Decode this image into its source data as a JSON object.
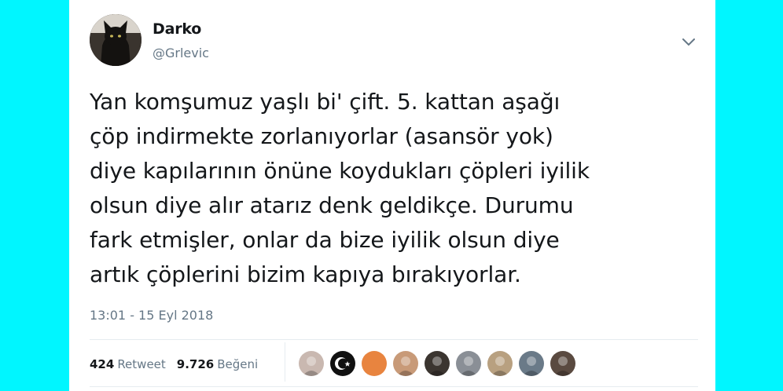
{
  "tweet": {
    "display_name": "Darko",
    "handle": "@Grlevic",
    "text_lines": [
      "Yan komşumuz yaşlı bi' çift. 5. kattan aşağı",
      "çöp indirmekte zorlanıyorlar (asansör yok)",
      "diye kapılarının önüne koydukları çöpleri iyilik",
      "olsun diye alır atarız denk geldikçe. Durumu",
      "fark etmişler, onlar da bize iyilik olsun diye",
      "artık çöplerini bizim kapıya bırakıyorlar."
    ],
    "timestamp": "13:01 - 15 Eyl 2018",
    "retweet_count": "424",
    "retweet_label": "Retweet",
    "like_count": "9.726",
    "like_label": "Beğeni"
  },
  "icons": {
    "caret": "chevron-down-icon",
    "avatar": "black-cat-avatar"
  },
  "likers": [
    {
      "name": "liker-avatar-1",
      "color": "#c9b8b0"
    },
    {
      "name": "liker-avatar-2",
      "color": "#111111"
    },
    {
      "name": "liker-avatar-3",
      "color": "#e8843f"
    },
    {
      "name": "liker-avatar-4",
      "color": "#c89a78"
    },
    {
      "name": "liker-avatar-5",
      "color": "#3b3530"
    },
    {
      "name": "liker-avatar-6",
      "color": "#8a8f96"
    },
    {
      "name": "liker-avatar-7",
      "color": "#b8a080"
    },
    {
      "name": "liker-avatar-8",
      "color": "#6a7a88"
    },
    {
      "name": "liker-avatar-9",
      "color": "#5a4a40"
    }
  ],
  "colors": {
    "background": "#00f6ff",
    "card": "#ffffff",
    "text": "#14171a",
    "secondary_text": "#657786"
  }
}
